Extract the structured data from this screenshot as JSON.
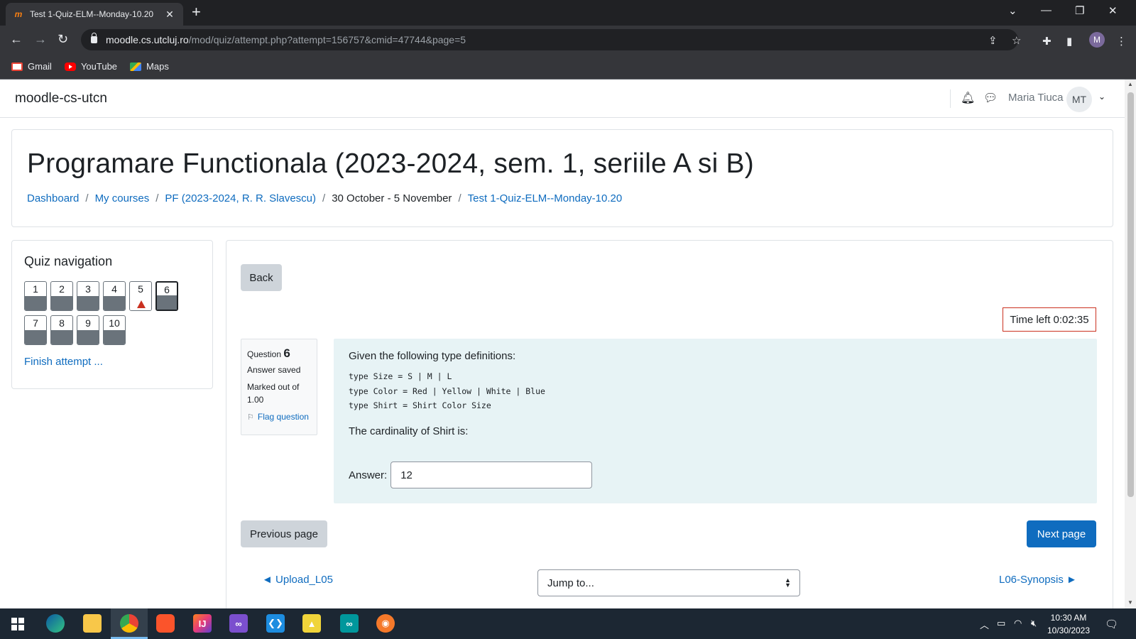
{
  "browser": {
    "tab_title": "Test 1-Quiz-ELM--Monday-10.20",
    "tab_close": "✕",
    "new_tab": "+",
    "url_host": "moodle.cs.utcluj.ro",
    "url_path": "/mod/quiz/attempt.php?attempt=156757&cmid=47744&page=5",
    "profile_initial": "M",
    "bookmarks": [
      {
        "label": "Gmail",
        "icon": "gmail-icon"
      },
      {
        "label": "YouTube",
        "icon": "youtube-icon"
      },
      {
        "label": "Maps",
        "icon": "maps-icon"
      }
    ]
  },
  "site": {
    "name": "moodle-cs-utcn",
    "user_name": "Maria Tiuca",
    "user_initials": "MT"
  },
  "header": {
    "title": "Programare Functionala (2023-2024, sem. 1, seriile A si B)",
    "breadcrumb": [
      {
        "label": "Dashboard",
        "link": true
      },
      {
        "label": "My courses",
        "link": true
      },
      {
        "label": "PF (2023-2024, R. R. Slavescu)",
        "link": true
      },
      {
        "label": "30 October - 5 November",
        "link": false
      },
      {
        "label": "Test 1-Quiz-ELM--Monday-10.20",
        "link": true
      }
    ]
  },
  "quiz_nav": {
    "title": "Quiz navigation",
    "questions": [
      {
        "num": "1",
        "state": "answered"
      },
      {
        "num": "2",
        "state": "answered"
      },
      {
        "num": "3",
        "state": "answered"
      },
      {
        "num": "4",
        "state": "answered"
      },
      {
        "num": "5",
        "state": "flagged"
      },
      {
        "num": "6",
        "state": "current"
      },
      {
        "num": "7",
        "state": "answered"
      },
      {
        "num": "8",
        "state": "answered"
      },
      {
        "num": "9",
        "state": "answered"
      },
      {
        "num": "10",
        "state": "answered"
      }
    ],
    "finish_label": "Finish attempt ..."
  },
  "main": {
    "back_label": "Back",
    "timer": "Time left 0:02:35",
    "question": {
      "label": "Question",
      "number": "6",
      "state": "Answer saved",
      "grade": "Marked out of 1.00",
      "flag_label": "Flag question",
      "intro": "Given the following type definitions:",
      "code": "type Size = S | M | L\ntype Color = Red | Yellow | White | Blue\ntype Shirt = Shirt Color Size",
      "prompt": "The cardinality of Shirt is:",
      "answer_label": "Answer:",
      "answer_value": "12"
    },
    "prev_label": "Previous page",
    "next_label": "Next page",
    "prev_activity": "◄ Upload_L05",
    "jump_label": "Jump to...",
    "next_activity": "L06-Synopsis ►"
  },
  "taskbar": {
    "time": "10:30 AM",
    "date": "10/30/2023",
    "active_app": "chrome"
  },
  "colors": {
    "primary": "#0f6cbf",
    "question_bg": "#e7f3f5",
    "timer_border": "#ca3120",
    "answered": "#6a737b"
  }
}
